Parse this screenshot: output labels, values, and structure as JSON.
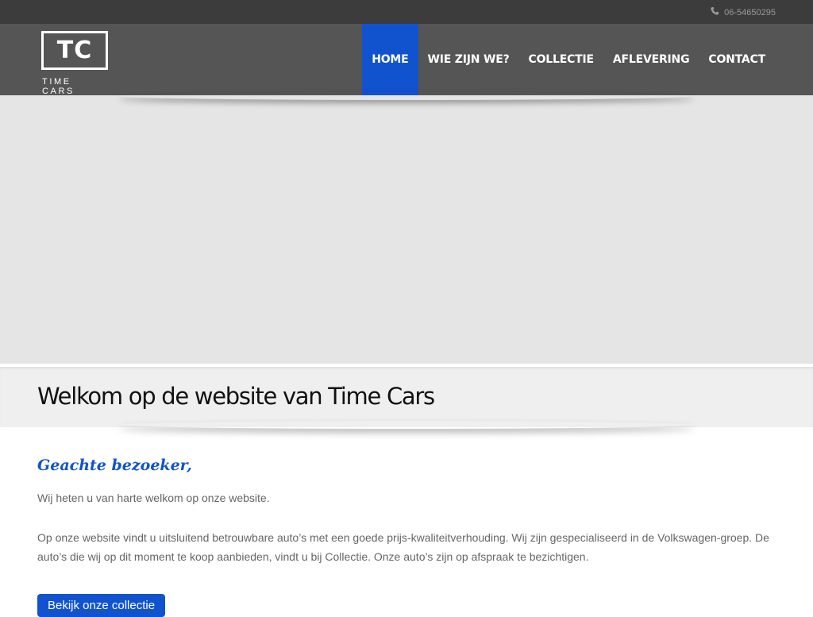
{
  "topbar": {
    "phone_icon": "phone-icon",
    "phone": "06-54650295"
  },
  "logo": {
    "mark": "TC",
    "name": "TIME CARS"
  },
  "nav": {
    "items": [
      {
        "label": "HOME",
        "active": true
      },
      {
        "label": "WIE ZIJN WE?",
        "active": false
      },
      {
        "label": "COLLECTIE",
        "active": false
      },
      {
        "label": "AFLEVERING",
        "active": false
      },
      {
        "label": "CONTACT",
        "active": false
      }
    ]
  },
  "page": {
    "title": "Welkom op de website van Time Cars"
  },
  "content": {
    "greeting": "Geachte bezoeker,",
    "paragraph1": "Wij heten u van harte welkom op onze website.",
    "paragraph2": "Op onze website vindt u uitsluitend betrouwbare auto’s met een goede prijs-kwaliteitverhouding. Wij zijn gespecialiseerd in de Volkswagen-groep. De auto’s die wij op dit moment te koop aanbieden, vindt u bij Collectie. Onze auto’s zijn op afspraak te bezichtigen.",
    "cta_label": "Bekijk onze collectie"
  },
  "colors": {
    "accent": "#1153cf",
    "topbar": "#3c3c3c",
    "header": "#555555",
    "hero": "#e5e5e5",
    "title_bar": "#efefef"
  }
}
